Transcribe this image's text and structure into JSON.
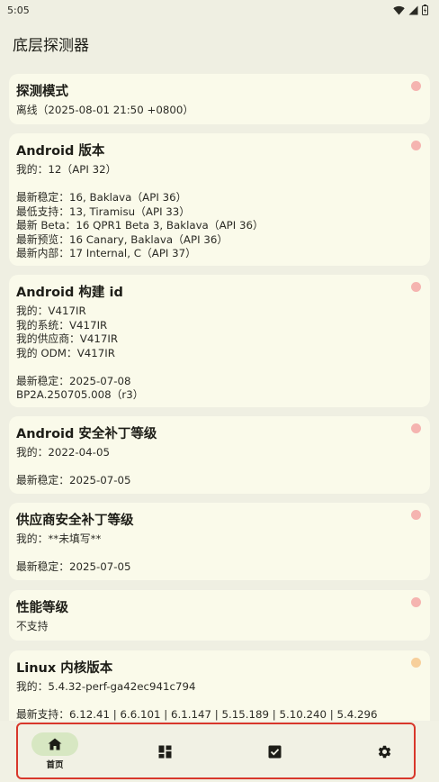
{
  "status_bar": {
    "time": "5:05"
  },
  "app": {
    "title": "底层探测器"
  },
  "colors": {
    "dot_red": "#f5b4b0",
    "dot_orange": "#f7cf9b",
    "accent": "#d7e7c2"
  },
  "cards": [
    {
      "title": "探测模式",
      "dot": "red",
      "lines": [
        "离线（2025-08-01 21:50 +0800）"
      ]
    },
    {
      "title": "Android 版本",
      "dot": "red",
      "lines": [
        "我的：12（API 32）",
        "",
        "最新稳定：16, Baklava（API 36）",
        "最低支持：13, Tiramisu（API 33）",
        "最新 Beta：16 QPR1 Beta 3, Baklava（API 36）",
        "最新预览：16 Canary, Baklava（API 36）",
        "最新内部：17 Internal, C（API 37）"
      ]
    },
    {
      "title": "Android 构建 id",
      "dot": "red",
      "lines": [
        "我的：V417IR",
        "我的系统：V417IR",
        "我的供应商：V417IR",
        "我的 ODM：V417IR",
        "",
        "最新稳定：2025-07-08",
        "BP2A.250705.008（r3）"
      ]
    },
    {
      "title": "Android 安全补丁等级",
      "dot": "red",
      "lines": [
        "我的：2022-04-05",
        "",
        "最新稳定：2025-07-05"
      ]
    },
    {
      "title": "供应商安全补丁等级",
      "dot": "red",
      "lines": [
        "我的：**未填写**",
        "",
        "最新稳定：2025-07-05"
      ]
    },
    {
      "title": "性能等级",
      "dot": "red",
      "lines": [
        "不支持"
      ]
    },
    {
      "title": "Linux 内核版本",
      "dot": "orange",
      "lines": [
        "我的：5.4.32-perf-ga42ec941c794",
        "",
        "最新支持：6.12.41 | 6.6.101 | 6.1.147 | 5.15.189 | 5.10.240 | 5.4.296"
      ]
    }
  ],
  "nav": [
    {
      "label": "首页",
      "icon": "home-icon",
      "active": true
    },
    {
      "label": "",
      "icon": "dashboard-icon",
      "active": false
    },
    {
      "label": "",
      "icon": "checkbox-icon",
      "active": false
    },
    {
      "label": "",
      "icon": "gear-icon",
      "active": false
    }
  ]
}
